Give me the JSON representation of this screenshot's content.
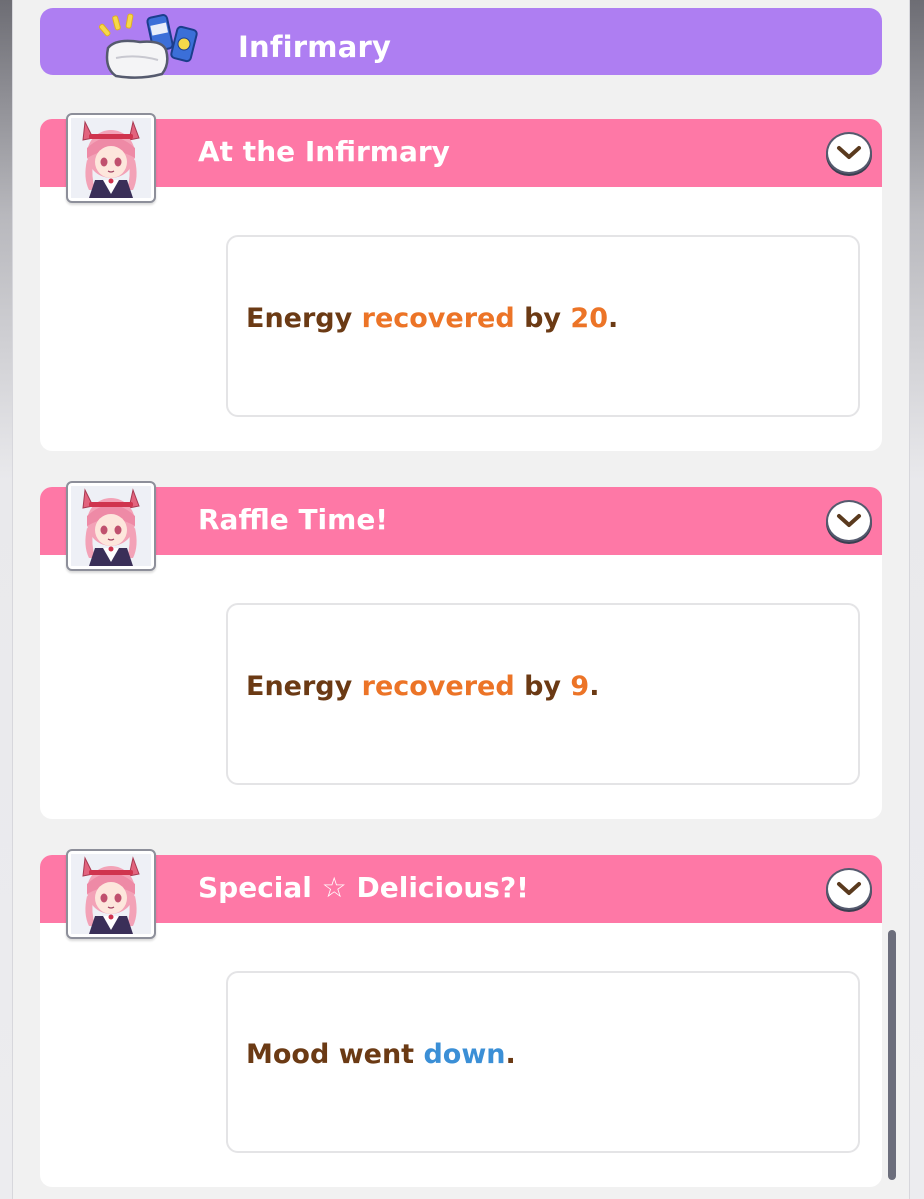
{
  "section": {
    "title": "Infirmary",
    "icon": "infirmary-pillow-and-drinks-icon",
    "color": "#ae7ef2"
  },
  "events": [
    {
      "title": "At the Infirmary",
      "result": {
        "pre": "Energy ",
        "highlight": "recovered",
        "mid": " by ",
        "value": "20",
        "post": "."
      }
    },
    {
      "title": "Raffle Time!",
      "result": {
        "pre": "Energy ",
        "highlight": "recovered",
        "mid": " by ",
        "value": "9",
        "post": "."
      }
    },
    {
      "title": "Special ☆ Delicious?!",
      "result": {
        "pre": "Mood went ",
        "highlight": "down",
        "post": "."
      }
    }
  ],
  "colors": {
    "event_header": "#fe78a6",
    "text_brown": "#6b3a14",
    "highlight_orange": "#ec7427",
    "highlight_blue": "#3b8fd6"
  }
}
